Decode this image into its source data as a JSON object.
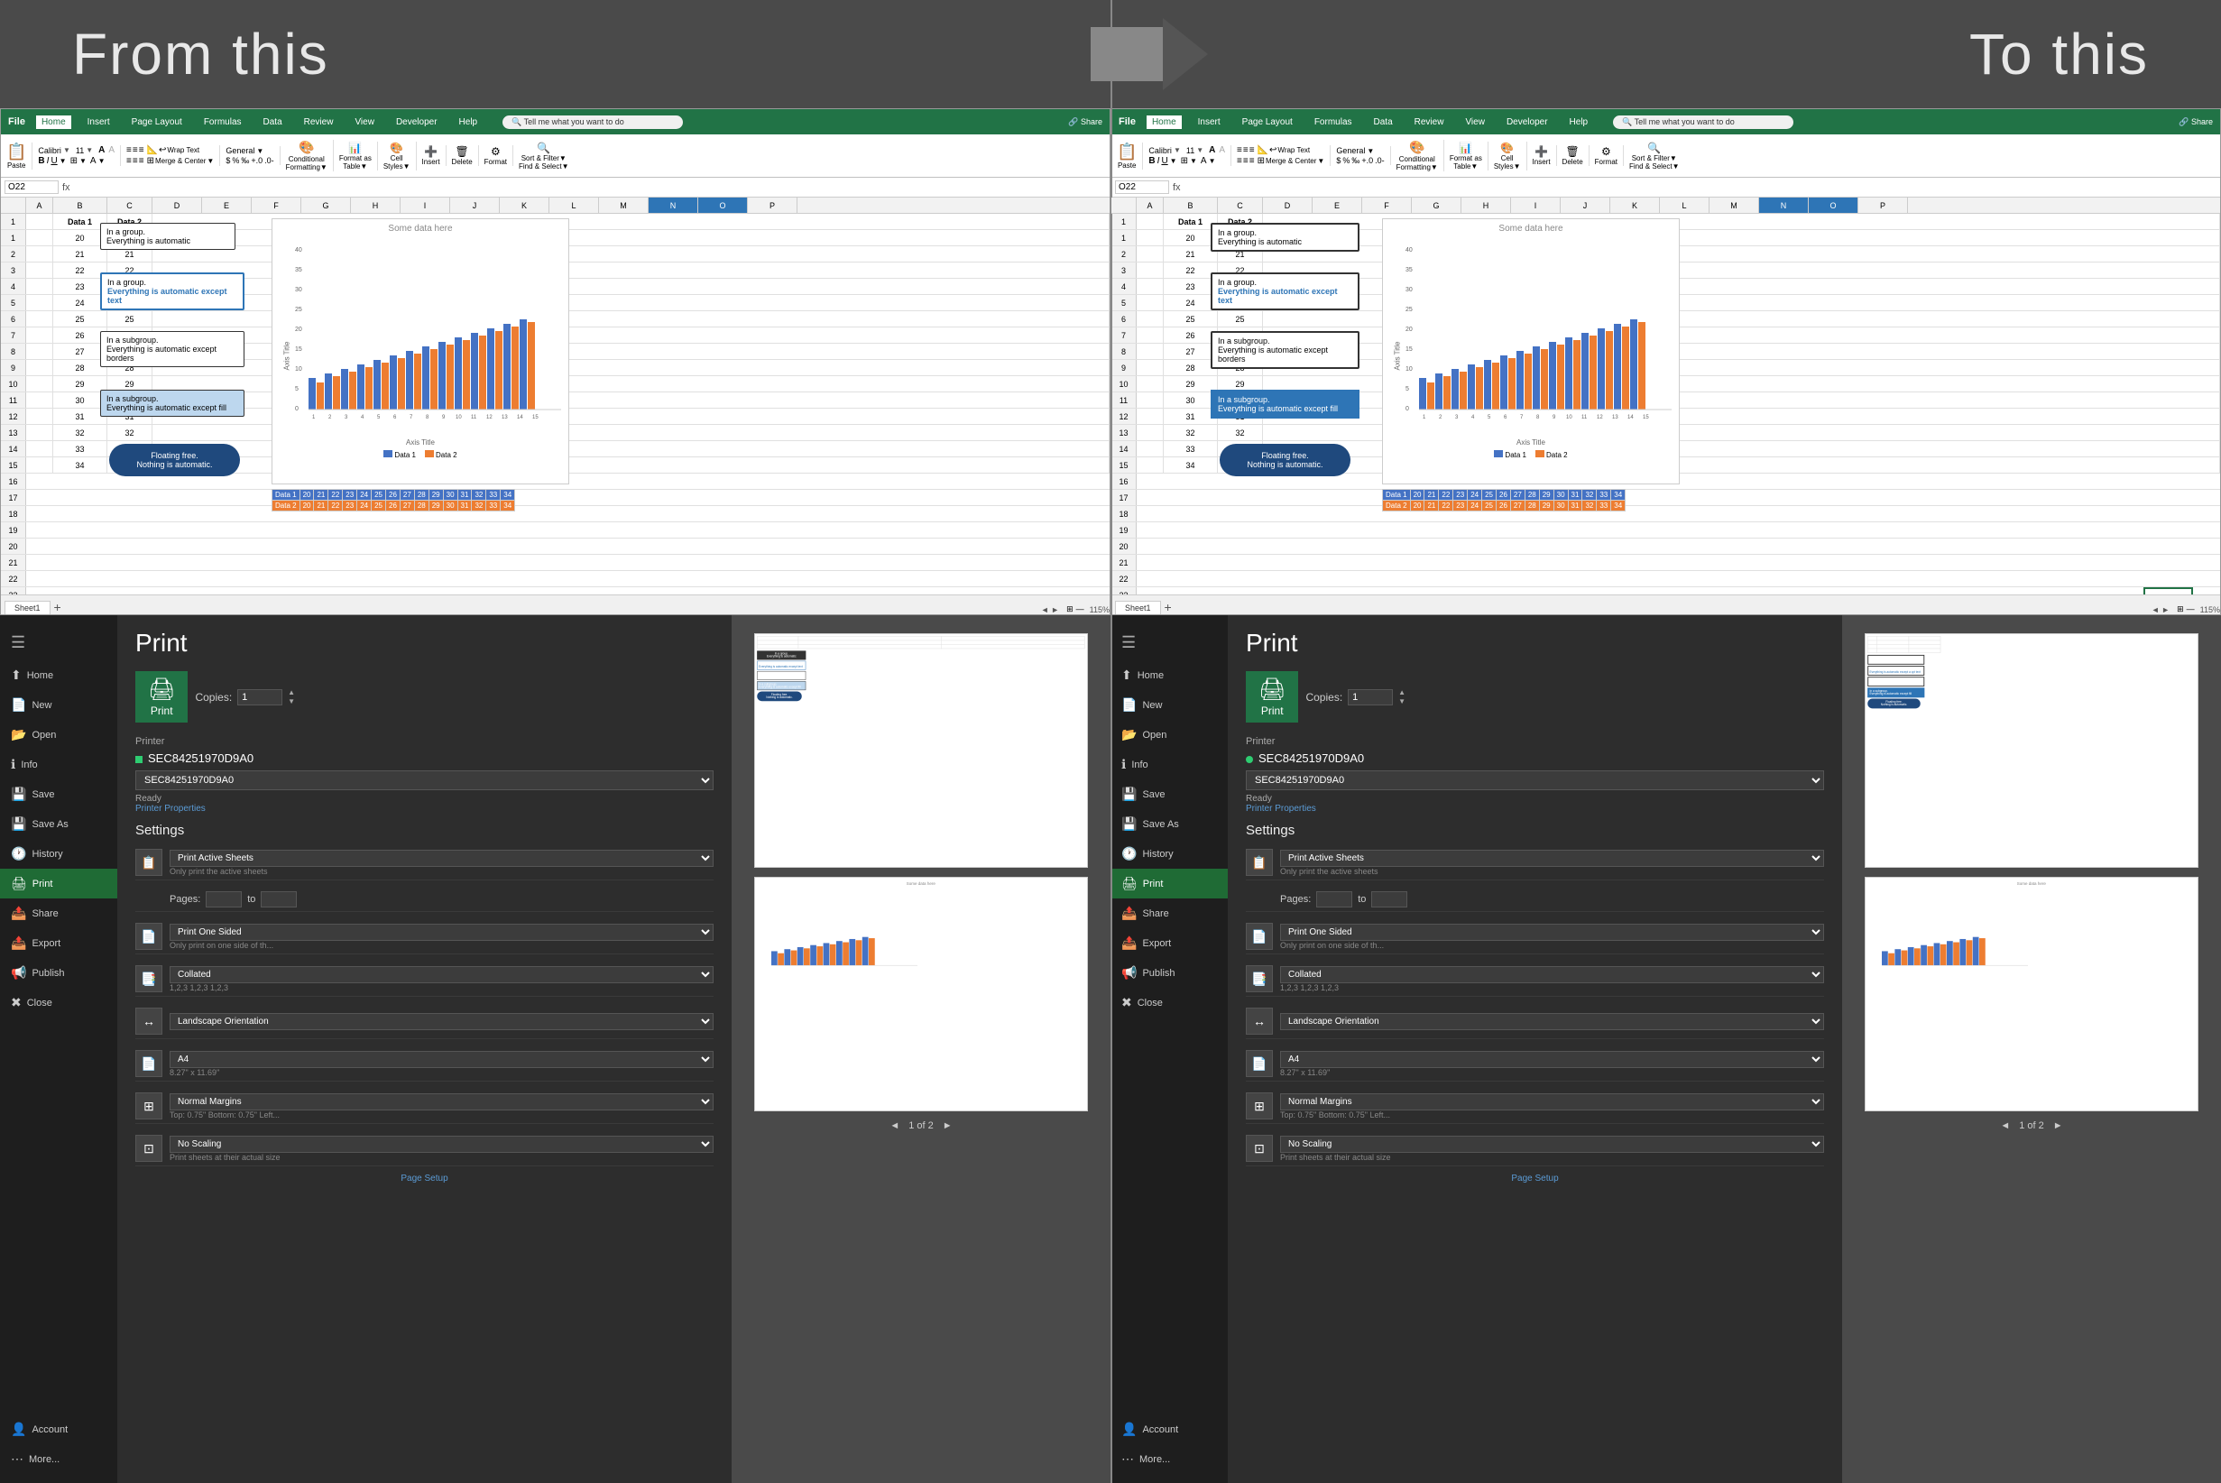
{
  "header": {
    "title_left": "From this",
    "title_right": "To this",
    "arrow": "➜"
  },
  "excel_left": {
    "ribbon_tabs": [
      "File",
      "Home",
      "Insert",
      "Page Layout",
      "Formulas",
      "Data",
      "Review",
      "View",
      "Developer",
      "Help"
    ],
    "active_tab": "Home",
    "formula_bar_cell": "O22",
    "sheet_tab": "Sheet1",
    "status_bar": "115%",
    "col_headers": [
      "",
      "A",
      "B",
      "C",
      "D",
      "E",
      "F",
      "G",
      "H",
      "I",
      "J",
      "K",
      "L",
      "M",
      "N",
      "O",
      "P"
    ],
    "data_col1": "Data 1",
    "data_col2": "Data 2",
    "chart_title": "Some data here",
    "axis_title": "Axis Title",
    "textboxes": [
      {
        "text": "In a group.\nEverything is automatic",
        "style": "normal"
      },
      {
        "text": "In a group.\nEverything is automatic except\ntext",
        "style": "blue-border"
      },
      {
        "text": "In a subgroup.\nEverything is automatic except\nborders",
        "style": "normal"
      },
      {
        "text": "In a subgroup.\nEverything is automatic except fill",
        "style": "blue-fill"
      },
      {
        "text": "Floating free.\nNothing is automatic.",
        "style": "rounded"
      }
    ]
  },
  "excel_right": {
    "ribbon_tabs": [
      "File",
      "Home",
      "Insert",
      "Page Layout",
      "Formulas",
      "Data",
      "Review",
      "View",
      "Developer",
      "Help"
    ],
    "active_tab": "Home",
    "formula_bar_cell": "O22",
    "sheet_tab": "Sheet1",
    "status_bar": "115%"
  },
  "print_left": {
    "title": "Print",
    "sidebar_items": [
      {
        "icon": "⬆",
        "label": "Home"
      },
      {
        "icon": "📄",
        "label": "New"
      },
      {
        "icon": "📂",
        "label": "Open"
      },
      {
        "icon": "ℹ",
        "label": "Info"
      },
      {
        "icon": "💾",
        "label": "Save"
      },
      {
        "icon": "💾",
        "label": "Save As"
      },
      {
        "icon": "🕐",
        "label": "History"
      },
      {
        "icon": "🖨",
        "label": "Print",
        "active": true
      },
      {
        "icon": "📤",
        "label": "Share"
      },
      {
        "icon": "📤",
        "label": "Export"
      },
      {
        "icon": "📢",
        "label": "Publish"
      },
      {
        "icon": "✖",
        "label": "Close"
      },
      {
        "icon": "👤",
        "label": "Account"
      },
      {
        "icon": "⋯",
        "label": "More..."
      }
    ],
    "copies_label": "Copies:",
    "copies_value": "1",
    "print_button": "Print",
    "printer_label": "Printer",
    "printer_name": "SEC84251970D9A0",
    "printer_status": "Ready",
    "printer_props": "Printer Properties",
    "settings_label": "Settings",
    "setting1_label": "Print Active Sheets",
    "setting1_sub": "Only print the active sheets",
    "pages_label": "Pages:",
    "pages_from": "",
    "pages_to": "to",
    "setting2_label": "Print One Sided",
    "setting2_sub": "Only print on one side of th...",
    "setting3_label": "Collated",
    "setting3_sub": "1,2,3  1,2,3  1,2,3",
    "setting4_label": "Landscape Orientation",
    "setting5_label": "A4",
    "setting5_sub": "8.27\" x 11.69\"",
    "setting6_label": "Normal Margins",
    "setting6_sub": "Top: 0.75\" Bottom: 0.75\" Left...",
    "setting7_label": "No Scaling",
    "setting7_sub": "Print sheets at their actual size",
    "page_setup": "Page Setup",
    "nav": "1 of 2"
  },
  "print_right": {
    "title": "Print",
    "copies_label": "Copies:",
    "copies_value": "1",
    "print_button": "Print",
    "printer_name": "SEC84251970D9A0",
    "printer_status": "Ready",
    "printer_props": "Printer Properties",
    "settings_label": "Settings",
    "setting1_label": "Print Active Sheets",
    "setting1_sub": "Only print the active sheets",
    "pages_label": "Pages:",
    "pages_to": "to",
    "setting2_label": "Print One Sided",
    "setting2_sub": "Only print on one side of th...",
    "setting3_label": "Collated",
    "setting3_sub": "1,2,3  1,2,3  1,2,3",
    "setting4_label": "Landscape Orientation",
    "setting5_label": "A4",
    "setting5_sub": "8.27\" x 11.69\"",
    "setting6_label": "Normal Margins",
    "setting6_sub": "Top: 0.75\" Bottom: 0.75\" Left...",
    "setting7_label": "No Scaling",
    "setting7_sub": "Print sheets at their actual size",
    "page_setup": "Page Setup",
    "nav": "1 of 2"
  }
}
